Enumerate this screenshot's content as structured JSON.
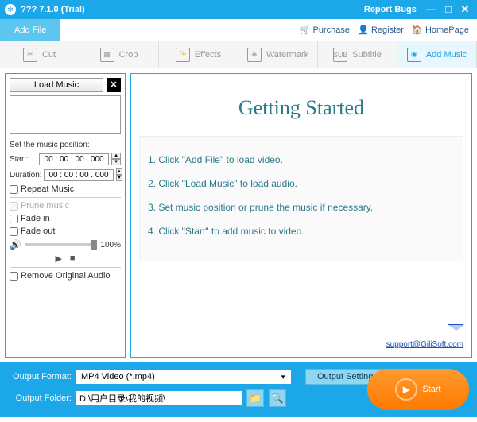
{
  "titlebar": {
    "title": "??? 7.1.0 (Trial)",
    "report": "Report Bugs"
  },
  "toplinks": {
    "purchase": "Purchase",
    "register": "Register",
    "homepage": "HomePage"
  },
  "addfile": "Add File",
  "tabs": {
    "cut": "Cut",
    "crop": "Crop",
    "effects": "Effects",
    "watermark": "Watermark",
    "subtitle": "Subtitle",
    "addmusic": "Add Music"
  },
  "side": {
    "loadmusic": "Load Music",
    "setpos": "Set the music position:",
    "startlbl": "Start:",
    "start": "00 : 00 : 00 . 000",
    "durlbl": "Duration:",
    "dur": "00 : 00 : 00 . 000",
    "repeat": "Repeat Music",
    "prune": "Prune music",
    "fadein": "Fade in",
    "fadeout": "Fade out",
    "vol": "100%",
    "remove": "Remove Original Audio"
  },
  "content": {
    "heading": "Getting Started",
    "s1": "1. Click \"Add File\" to load video.",
    "s2": "2. Click \"Load Music\" to load audio.",
    "s3": "3. Set music position or prune the music if necessary.",
    "s4": "4. Click \"Start\" to add music to video.",
    "support": "support@GiliSoft.com"
  },
  "bottom": {
    "fmtlbl": "Output Format:",
    "fmt": "MP4 Video (*.mp4)",
    "outset": "Output Settings",
    "follbl": "Output Folder:",
    "folder": "D:\\用户目录\\我的视频\\",
    "start": "Start"
  }
}
